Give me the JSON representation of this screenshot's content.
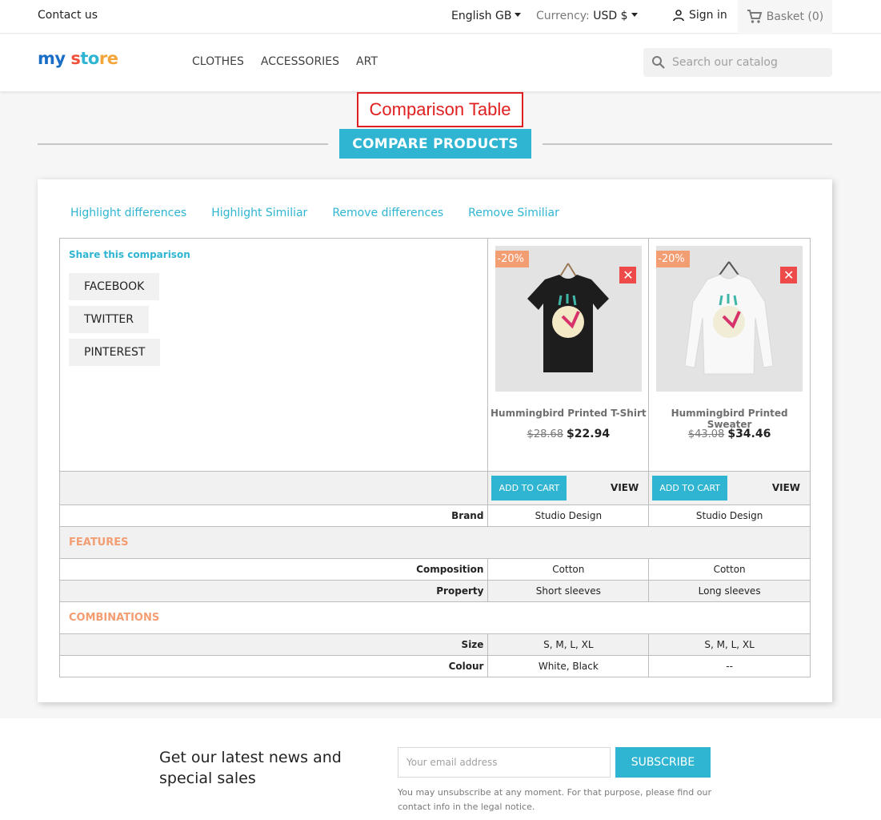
{
  "topbar": {
    "contact": "Contact us",
    "language": "English GB",
    "currency_label": "Currency:",
    "currency_value": "USD $",
    "signin": "Sign in",
    "basket": "Basket (0)"
  },
  "header": {
    "logo": {
      "part1": "my",
      "part2": "s",
      "part3": "to",
      "part4": "re"
    },
    "nav": [
      "CLOTHES",
      "ACCESSORIES",
      "ART"
    ],
    "search_placeholder": "Search our catalog"
  },
  "annotation": "Comparison Table",
  "heading": "COMPARE PRODUCTS",
  "actions": [
    "Highlight differences",
    "Highlight Similiar",
    "Remove differences",
    "Remove Similiar"
  ],
  "share": {
    "title": "Share this comparison",
    "buttons": [
      "FACEBOOK",
      "TWITTER",
      "PINTEREST"
    ]
  },
  "products": [
    {
      "name": "Hummingbird Printed T-Shirt",
      "discount": "-20%",
      "old_price": "$28.68",
      "price": "$22.94",
      "add_to_cart": "ADD TO CART",
      "view": "VIEW",
      "shirt_color": "#1d1d1d"
    },
    {
      "name": "Hummingbird Printed Sweater",
      "discount": "-20%",
      "old_price": "$43.08",
      "price": "$34.46",
      "add_to_cart": "ADD TO CART",
      "view": "VIEW",
      "shirt_color": "#f8f8f8"
    }
  ],
  "rows": {
    "brand": {
      "label": "Brand",
      "values": [
        "Studio Design",
        "Studio Design"
      ]
    },
    "features_title": "FEATURES",
    "composition": {
      "label": "Composition",
      "values": [
        "Cotton",
        "Cotton"
      ]
    },
    "property": {
      "label": "Property",
      "values": [
        "Short sleeves",
        "Long sleeves"
      ]
    },
    "combinations_title": "COMBINATIONS",
    "size": {
      "label": "Size",
      "values": [
        "S, M, L, XL",
        "S, M, L, XL"
      ]
    },
    "colour": {
      "label": "Colour",
      "values": [
        "White, Black",
        "--"
      ]
    }
  },
  "newsletter": {
    "title": "Get our latest news and special sales",
    "email_placeholder": "Your email address",
    "subscribe": "SUBSCRIBE",
    "disclaimer": "You may unsubscribe at any moment. For that purpose, please find our contact info in the legal notice."
  },
  "colors": {
    "accent": "#2fb5d2",
    "discount": "#f39d72",
    "remove": "#ee4a4a"
  }
}
